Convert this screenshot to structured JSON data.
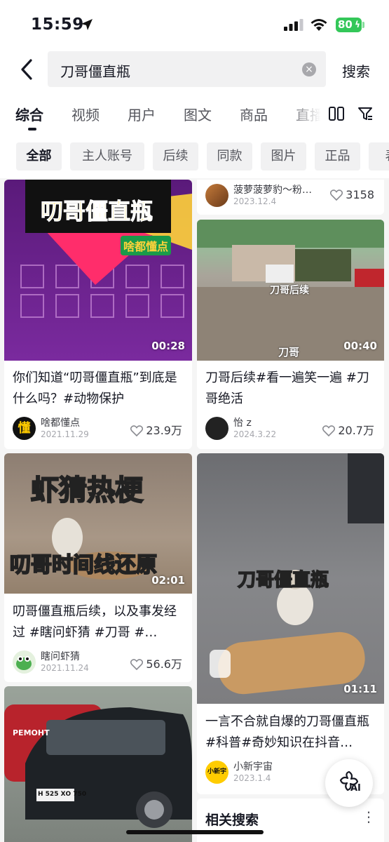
{
  "status_bar": {
    "time": "15:59",
    "battery": "80"
  },
  "search": {
    "query": "刀哥僵直瓶",
    "submit_label": "搜索"
  },
  "tabs": [
    {
      "label": "综合"
    },
    {
      "label": "视频"
    },
    {
      "label": "用户"
    },
    {
      "label": "图文"
    },
    {
      "label": "商品"
    },
    {
      "label": "直播"
    }
  ],
  "filters": [
    {
      "label": "全部"
    },
    {
      "label": "主人账号"
    },
    {
      "label": "后续"
    },
    {
      "label": "同款"
    },
    {
      "label": "图片"
    },
    {
      "label": "正品"
    },
    {
      "label": "表"
    }
  ],
  "cards": [
    {
      "thumb_text": "叨哥僵直瓶",
      "badge_text": "啥都懂点",
      "duration": "00:28",
      "title": "你们知道“叨哥僵直瓶”到底是什么吗？#动物保护",
      "author": "啥都懂点",
      "avatar_text": "懂",
      "date": "2021.11.29",
      "likes": "23.9万"
    },
    {
      "author": "菠萝菠萝豹～粉…",
      "date": "2023.12.4",
      "likes": "3158"
    },
    {
      "thumb_text": "刀哥后续",
      "thumb_text_2": "刀哥",
      "duration": "00:40",
      "title": "刀哥后续#看一遍笑一遍 #刀哥绝活",
      "author": "怡 z",
      "date": "2024.3.22",
      "likes": "20.7万"
    },
    {
      "thumb_text": "虾猜热梗",
      "thumb_text_2": "叨哥时间线还原",
      "duration": "02:01",
      "title": "叨哥僵直瓶后续，以及事发经过 #瞎问虾猜 #刀哥 #…",
      "author": "瞎问虾猜",
      "date": "2021.11.24",
      "likes": "56.6万"
    },
    {
      "thumb_text": "刀哥僵直瓶",
      "duration": "01:11",
      "title": "一言不合就自爆的刀哥僵直瓶#科普#奇妙知识在抖音…",
      "author": "小新宇宙",
      "avatar_text": "小新宇宙",
      "date": "2023.1.4",
      "likes": ""
    },
    {
      "thumb_text": "РЕМОНТ",
      "plate_text": "Н 525 ХО 750"
    }
  ],
  "ai_button": {
    "label": "AI"
  },
  "related": {
    "label": "相关搜索"
  },
  "colors": {
    "accent_battery": "#34c759",
    "purple_thumb": "#6b1d8c",
    "text_primary": "#161823"
  }
}
